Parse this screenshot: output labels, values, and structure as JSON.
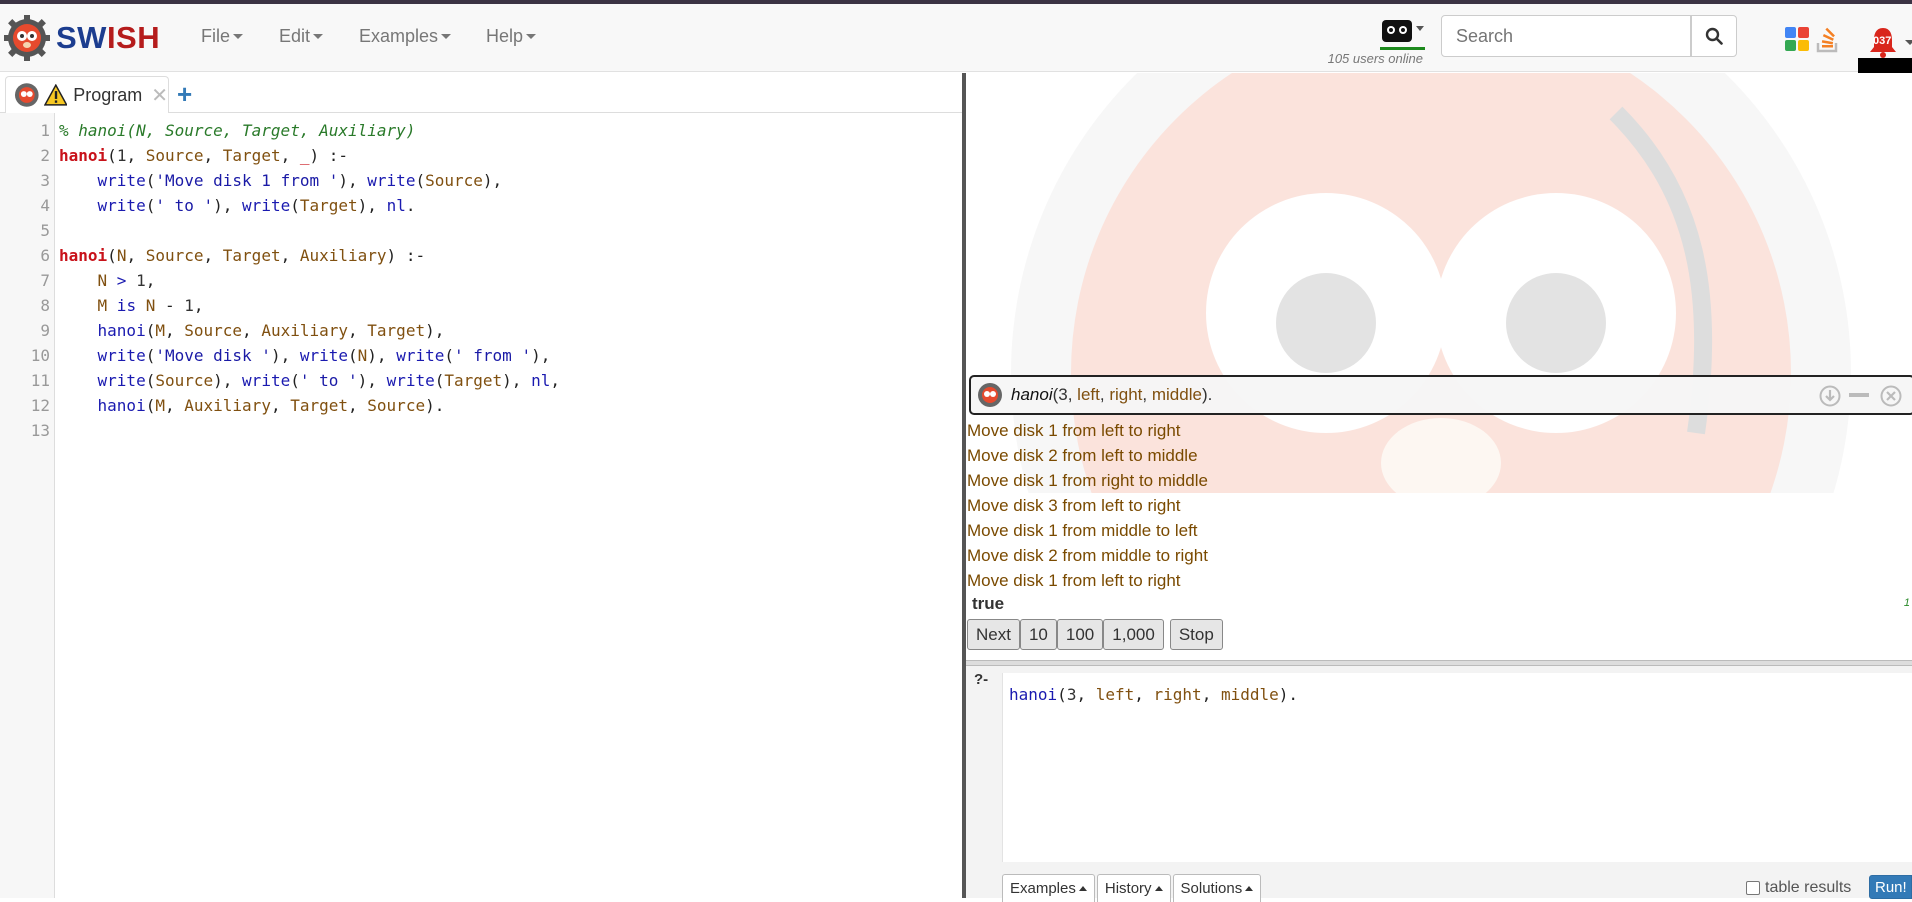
{
  "navbar": {
    "brand": "SWISH",
    "brand_a": "SW",
    "brand_b": "ISH",
    "menus": [
      "File",
      "Edit",
      "Examples",
      "Help"
    ],
    "users_online": "105 users online",
    "search_placeholder": "Search",
    "notifications": "037"
  },
  "editor": {
    "tab_label": "Program",
    "line_numbers": [
      "1",
      "2",
      "3",
      "4",
      "5",
      "6",
      "7",
      "8",
      "9",
      "10",
      "11",
      "12",
      "13"
    ]
  },
  "results": {
    "query_head": "hanoi",
    "query_open": "(3, ",
    "query_args": [
      "left",
      "right",
      "middle"
    ],
    "query_close": ").",
    "output": [
      "Move disk 1 from left to right",
      "Move disk 2 from left to middle",
      "Move disk 1 from right to middle",
      "Move disk 3 from left to right",
      "Move disk 1 from middle to left",
      "Move disk 2 from middle to right",
      "Move disk 1 from left to right"
    ],
    "answer": "true",
    "runtime": "1",
    "buttons": [
      "Next",
      "10",
      "100",
      "1,000",
      "Stop"
    ]
  },
  "query_editor": {
    "prompt": "?-",
    "tabs": [
      "Examples",
      "History",
      "Solutions"
    ],
    "table_results": "table results",
    "run": "Run!"
  },
  "colors": {
    "accent": "#337ab7",
    "brand_blue": "#1c3d8f",
    "brand_red": "#b51c1c",
    "output_text": "#7a4a00"
  }
}
